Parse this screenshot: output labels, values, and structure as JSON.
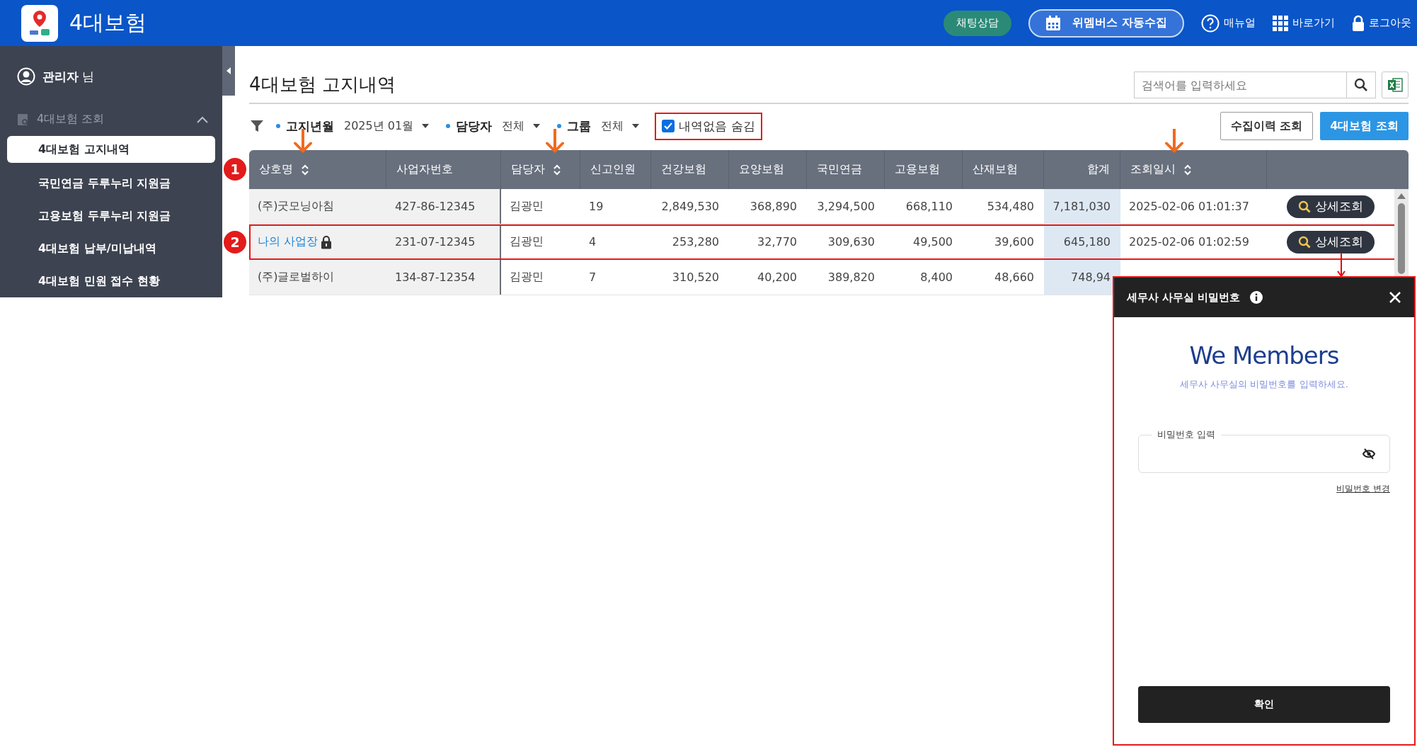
{
  "header": {
    "title": "4대보험",
    "actions": [
      {
        "kind": "chat",
        "label": "채팅상담"
      },
      {
        "kind": "collect",
        "label": "위멤버스 자동수집"
      },
      {
        "kind": "manual",
        "label": "매뉴얼"
      },
      {
        "kind": "shortcut",
        "label": "바로가기"
      },
      {
        "kind": "logout",
        "label": "로그아웃"
      }
    ]
  },
  "sidebar": {
    "user": {
      "name": "관리자",
      "suffix": "님"
    },
    "section": {
      "label": "4대보험 조회",
      "expanded": true
    },
    "items": [
      {
        "label": "4대보험 고지내역",
        "selected": true
      },
      {
        "label": "국민연금 두루누리 지원금",
        "selected": false
      },
      {
        "label": "고용보험 두루누리 지원금",
        "selected": false
      },
      {
        "label": "4대보험 납부/미납내역",
        "selected": false
      },
      {
        "label": "4대보험 민원 접수 현황",
        "selected": false
      }
    ]
  },
  "page": {
    "title": "4대보험 고지내역",
    "search": {
      "placeholder": "검색어를 입력하세요"
    }
  },
  "filters": [
    {
      "label": "고지년월",
      "value": "2025년 01월"
    },
    {
      "label": "담당자",
      "value": "전체"
    },
    {
      "label": "그룹",
      "value": "전체"
    }
  ],
  "hide_empty": {
    "label": "내역없음 숨김",
    "checked": true,
    "outlined": true
  },
  "buttons": [
    {
      "kind": "secondary",
      "label": "수집이력 조회"
    },
    {
      "kind": "primary",
      "label": "4대보험 조회"
    }
  ],
  "table": {
    "marker": "1",
    "columns": [
      {
        "label": "상호명",
        "sortable": true,
        "arrow": true
      },
      {
        "label": "사업자번호",
        "sortable": false,
        "arrow": false
      },
      {
        "label": "담당자",
        "sortable": true,
        "arrow": true
      },
      {
        "label": "신고인원",
        "sortable": false,
        "arrow": false
      },
      {
        "label": "건강보험",
        "sortable": false,
        "arrow": false
      },
      {
        "label": "요양보험",
        "sortable": false,
        "arrow": false
      },
      {
        "label": "국민연금",
        "sortable": false,
        "arrow": false
      },
      {
        "label": "고용보험",
        "sortable": false,
        "arrow": false
      },
      {
        "label": "산재보험",
        "sortable": false,
        "arrow": false
      },
      {
        "label": "합계",
        "sortable": false,
        "arrow": false
      },
      {
        "label": "조회일시",
        "sortable": true,
        "arrow": true
      }
    ],
    "rows": [
      {
        "cells": [
          "(주)굿모닝아침",
          "427-86-12345",
          "김광민",
          "19",
          "2,849,530",
          "368,890",
          "3,294,500",
          "668,110",
          "534,480",
          "7,181,030",
          "2025-02-06 01:01:37"
        ],
        "locked": false,
        "outlined": false,
        "action": "상세조회"
      },
      {
        "cells": [
          "나의 사업장",
          "231-07-12345",
          "김광민",
          "4",
          "253,280",
          "32,770",
          "309,630",
          "49,500",
          "39,600",
          "645,180",
          "2025-02-06 01:02:59"
        ],
        "locked": true,
        "outlined": true,
        "marker": "2",
        "action": "상세조회"
      },
      {
        "cells": [
          "(주)글로벌하이",
          "134-87-12354",
          "김광민",
          "7",
          "310,520",
          "40,200",
          "389,820",
          "8,400",
          "48,660",
          "748,94"
        ],
        "locked": false,
        "outlined": false
      }
    ]
  },
  "modal": {
    "title": "세무사 사무실 비밀번호",
    "brand": "We Members",
    "subtitle": "세무사 사무실의 비밀번호를 입력하세요.",
    "field_label": "비밀번호 입력",
    "link": "비밀번호 변경",
    "confirm": "확인",
    "outlined": true
  }
}
